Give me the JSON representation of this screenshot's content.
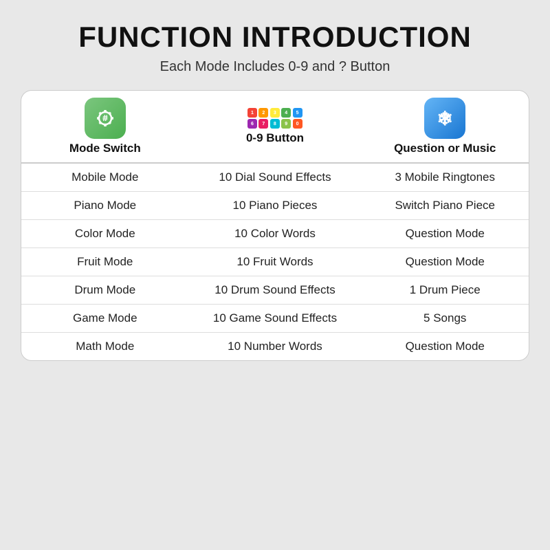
{
  "title": "FUNCTION INTRODUCTION",
  "subtitle": "Each Mode Includes 0-9 and ? Button",
  "table": {
    "headers": [
      {
        "id": "mode-switch",
        "label": "Mode Switch"
      },
      {
        "id": "button-09",
        "label": "0-9 Button"
      },
      {
        "id": "question-music",
        "label": "Question or Music"
      }
    ],
    "rows": [
      {
        "mode": "Mobile Mode",
        "button": "10 Dial Sound Effects",
        "question": "3 Mobile Ringtones"
      },
      {
        "mode": "Piano Mode",
        "button": "10 Piano Pieces",
        "question": "Switch Piano Piece"
      },
      {
        "mode": "Color Mode",
        "button": "10 Color Words",
        "question": "Question Mode"
      },
      {
        "mode": "Fruit Mode",
        "button": "10 Fruit Words",
        "question": "Question Mode"
      },
      {
        "mode": "Drum Mode",
        "button": "10 Drum Sound Effects",
        "question": "1 Drum Piece"
      },
      {
        "mode": "Game Mode",
        "button": "10 Game Sound Effects",
        "question": "5 Songs"
      },
      {
        "mode": "Math Mode",
        "button": "10 Number Words",
        "question": "Question Mode"
      }
    ],
    "icon_grid_colors": [
      "#f44336",
      "#ff9800",
      "#ffeb3b",
      "#4caf50",
      "#2196f3",
      "#9c27b0",
      "#e91e63",
      "#00bcd4",
      "#8bc34a",
      "#ff5722"
    ],
    "icon_grid_numbers": [
      "1",
      "2",
      "3",
      "4",
      "5",
      "6",
      "7",
      "8",
      "9",
      "0"
    ]
  }
}
